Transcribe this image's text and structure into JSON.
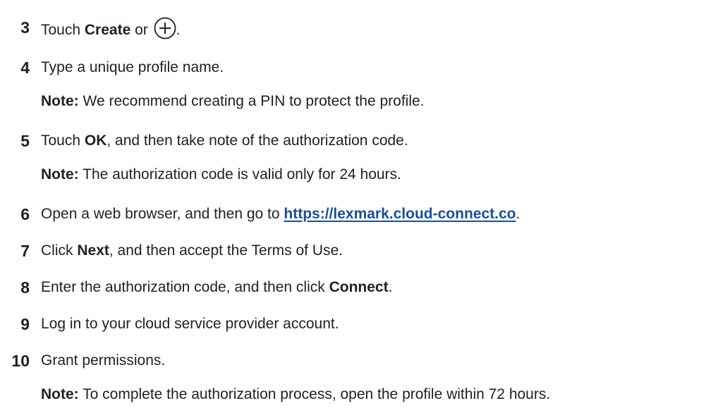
{
  "steps": [
    {
      "number": "3",
      "parts": [
        "Touch ",
        "Create",
        " or ",
        "."
      ]
    },
    {
      "number": "4",
      "text": "Type a unique profile name.",
      "note_label": "Note:",
      "note_text": " We recommend creating a PIN to protect the profile."
    },
    {
      "number": "5",
      "parts": [
        "Touch ",
        "OK",
        ", and then take note of the authorization code."
      ],
      "note_label": "Note:",
      "note_text": " The authorization code is valid only for 24 hours."
    },
    {
      "number": "6",
      "parts": [
        "Open a web browser, and then go to ",
        "https://lexmark.cloud-connect.co",
        "."
      ]
    },
    {
      "number": "7",
      "parts": [
        "Click ",
        "Next",
        ", and then accept the Terms of Use."
      ]
    },
    {
      "number": "8",
      "parts": [
        "Enter the authorization code, and then click ",
        "Connect",
        "."
      ]
    },
    {
      "number": "9",
      "text": "Log in to your cloud service provider account."
    },
    {
      "number": "10",
      "text": "Grant permissions.",
      "note_label": "Note:",
      "note_text": " To complete the authorization process, open the profile within 72 hours."
    }
  ],
  "icons": {
    "create_icon": "plus-circle-icon"
  },
  "colors": {
    "text": "#231f20",
    "link": "#1a4f96"
  }
}
